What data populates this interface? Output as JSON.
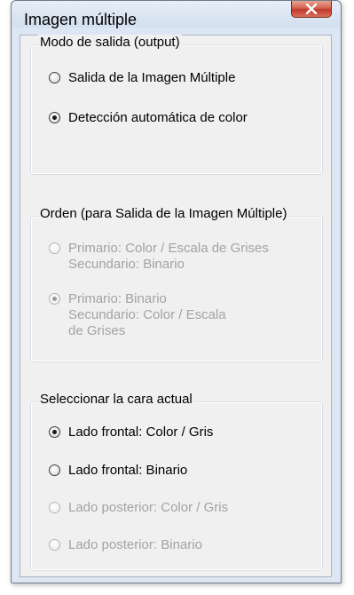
{
  "window": {
    "title": "Imagen múltiple"
  },
  "groups": {
    "output_mode": {
      "title": "Modo de salida (output)",
      "options": [
        {
          "lines": [
            "Salida de la Imagen Múltiple"
          ],
          "checked": false,
          "enabled": true
        },
        {
          "lines": [
            "Detección automática de color"
          ],
          "checked": true,
          "enabled": true
        }
      ]
    },
    "order": {
      "title": "Orden (para Salida de la Imagen Múltiple)",
      "options": [
        {
          "lines": [
            "Primario: Color / Escala de Grises",
            "Secundario: Binario"
          ],
          "checked": false,
          "enabled": false
        },
        {
          "lines": [
            "Primario: Binario",
            "Secundario: Color / Escala",
            "de Grises"
          ],
          "checked": true,
          "enabled": false
        }
      ]
    },
    "current_side": {
      "title": "Seleccionar la cara actual",
      "options": [
        {
          "lines": [
            "Lado frontal: Color / Gris"
          ],
          "checked": true,
          "enabled": true
        },
        {
          "lines": [
            "Lado frontal: Binario"
          ],
          "checked": false,
          "enabled": true
        },
        {
          "lines": [
            "Lado posterior: Color / Gris"
          ],
          "checked": false,
          "enabled": false
        },
        {
          "lines": [
            "Lado posterior: Binario"
          ],
          "checked": false,
          "enabled": false
        }
      ]
    }
  }
}
